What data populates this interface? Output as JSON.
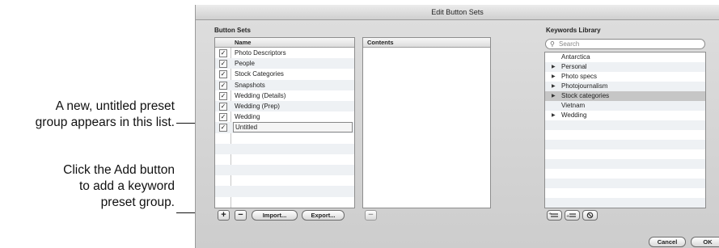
{
  "callouts": {
    "list_note": [
      "A new, untitled preset",
      "group appears in this list."
    ],
    "add_note": [
      "Click the Add button",
      "to add a keyword",
      "preset group."
    ]
  },
  "window": {
    "title": "Edit Button Sets"
  },
  "button_sets": {
    "section_label": "Button Sets",
    "column_name": "Name",
    "rows": [
      {
        "label": "Photo Descriptors",
        "checked": true
      },
      {
        "label": "People",
        "checked": true
      },
      {
        "label": "Stock Categories",
        "checked": true
      },
      {
        "label": "Snapshots",
        "checked": true
      },
      {
        "label": "Wedding (Details)",
        "checked": true
      },
      {
        "label": "Wedding (Prep)",
        "checked": true
      },
      {
        "label": "Wedding",
        "checked": true
      },
      {
        "label": "Untitled",
        "checked": true
      }
    ],
    "add_label": "+",
    "remove_label": "−",
    "import_label": "Import...",
    "export_label": "Export..."
  },
  "contents": {
    "column_name": "Contents",
    "remove_label": "−"
  },
  "keywords_library": {
    "section_label": "Keywords Library",
    "search_placeholder": "Search",
    "items": [
      {
        "label": "Antarctica",
        "expandable": false
      },
      {
        "label": "Personal",
        "expandable": true
      },
      {
        "label": "Photo specs",
        "expandable": true
      },
      {
        "label": "Photojournalism",
        "expandable": true
      },
      {
        "label": "Stock categories",
        "expandable": true,
        "highlighted": true
      },
      {
        "label": "Vietnam",
        "expandable": false
      },
      {
        "label": "Wedding",
        "expandable": true
      }
    ]
  },
  "dialog_buttons": {
    "cancel_label": "Cancel",
    "ok_label": "OK"
  }
}
